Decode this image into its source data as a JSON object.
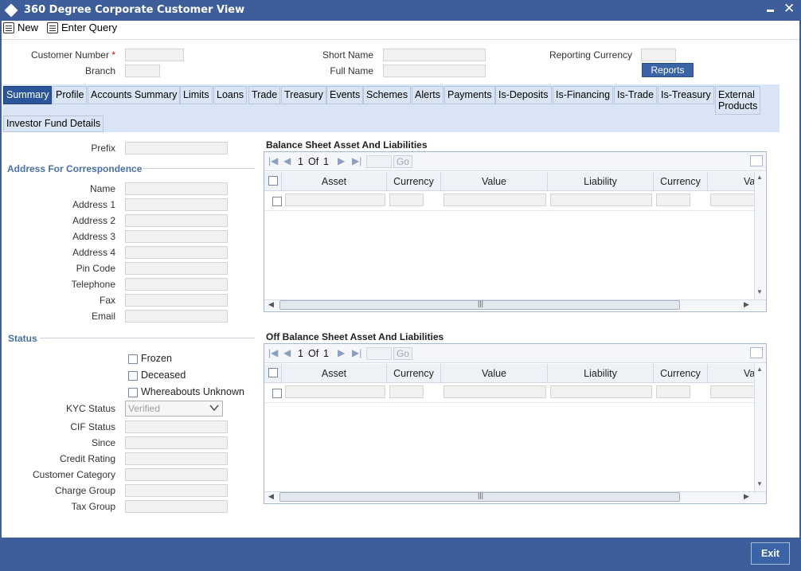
{
  "window": {
    "title": "360 Degree Corporate Customer View"
  },
  "toolbar": {
    "new_label": "New",
    "enter_query_label": "Enter Query"
  },
  "header": {
    "customer_number_label": "Customer Number",
    "required_mark": "*",
    "branch_label": "Branch",
    "short_name_label": "Short Name",
    "full_name_label": "Full Name",
    "reporting_currency_label": "Reporting Currency",
    "reports_button": "Reports"
  },
  "tabs": [
    "Summary",
    "Profile",
    "Accounts Summary",
    "Limits",
    "Loans",
    "Trade",
    "Treasury",
    "Events",
    "Schemes",
    "Alerts",
    "Payments",
    "Is-Deposits",
    "Is-Financing",
    "Is-Trade",
    "Is-Treasury"
  ],
  "tab_external_line1": "External",
  "tab_external_line2": "Products",
  "tab_investor": "Investor Fund Details",
  "left": {
    "prefix_label": "Prefix",
    "address_section": "Address For Correspondence",
    "name_label": "Name",
    "address1_label": "Address 1",
    "address2_label": "Address 2",
    "address3_label": "Address 3",
    "address4_label": "Address 4",
    "pin_label": "Pin Code",
    "telephone_label": "Telephone",
    "fax_label": "Fax",
    "email_label": "Email",
    "status_section": "Status",
    "frozen_label": "Frozen",
    "deceased_label": "Deceased",
    "whereabouts_label": "Whereabouts Unknown",
    "kyc_label": "KYC Status",
    "kyc_value": "Verified",
    "cif_label": "CIF Status",
    "since_label": "Since",
    "credit_label": "Credit Rating",
    "category_label": "Customer Category",
    "charge_label": "Charge Group",
    "tax_label": "Tax Group"
  },
  "grid1": {
    "title": "Balance Sheet Asset And Liabilities",
    "page_current": "1",
    "page_of": "Of",
    "page_total": "1",
    "go_label": "Go",
    "columns": [
      "Asset",
      "Currency",
      "Value",
      "Liability",
      "Currency",
      "Va"
    ]
  },
  "grid2": {
    "title": "Off Balance Sheet Asset And Liabilities",
    "page_current": "1",
    "page_of": "Of",
    "page_total": "1",
    "go_label": "Go",
    "columns": [
      "Asset",
      "Currency",
      "Value",
      "Liability",
      "Currency",
      "Va"
    ]
  },
  "footer": {
    "exit_label": "Exit"
  },
  "colors": {
    "brand": "#3d5e9b",
    "tab_active": "#2c5599",
    "section_title": "#4a6fa5"
  }
}
